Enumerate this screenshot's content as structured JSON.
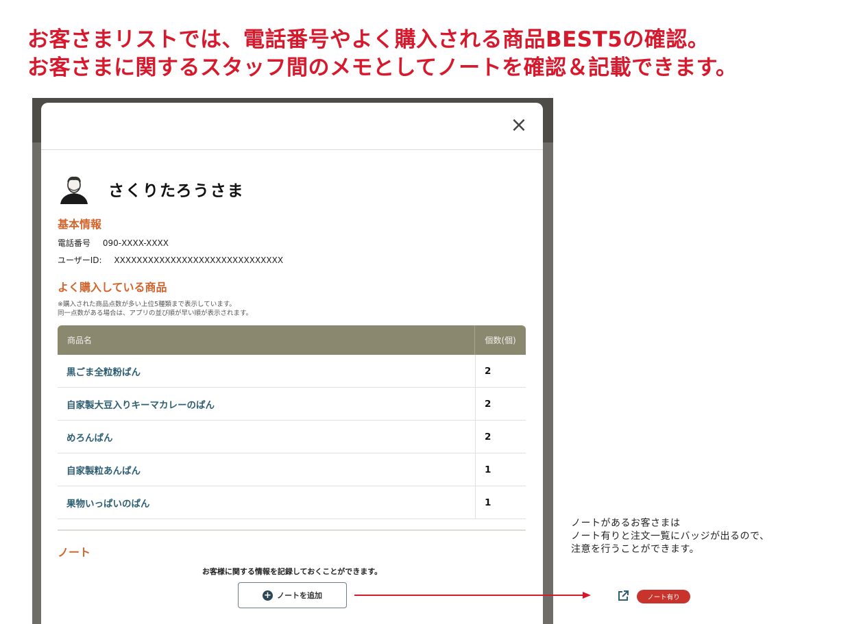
{
  "headline": {
    "line1": "お客さまリストでは、電話番号やよく購入される商品BEST5の確認。",
    "line2": "お客さまに関するスタッフ間のメモとしてノートを確認＆記載できます。"
  },
  "modal": {
    "close_label": "×",
    "customer_name": "さくりたろうさま",
    "basic_info": {
      "title": "基本情報",
      "phone_label": "電話番号",
      "phone_value": "090-XXXX-XXXX",
      "userid_label": "ユーザーID:",
      "userid_value": "XXXXXXXXXXXXXXXXXXXXXXXXXXXXXX"
    },
    "products": {
      "title": "よく購入している商品",
      "note_line1": "※購入された商品点数が多い上位5種類まで表示しています。",
      "note_line2": "同一点数がある場合は、アプリの並び順が早い順が表示されます。",
      "headers": [
        "商品名",
        "個数(個)"
      ],
      "rows": [
        {
          "name": "黒ごま全粒粉ぱん",
          "qty": "2"
        },
        {
          "name": "自家製大豆入りキーマカレーのぱん",
          "qty": "2"
        },
        {
          "name": "めろんぱん",
          "qty": "2"
        },
        {
          "name": "自家製粒あんぱん",
          "qty": "1"
        },
        {
          "name": "果物いっぱいのぱん",
          "qty": "1"
        }
      ]
    },
    "note": {
      "title": "ノート",
      "description": "お客様に関する情報を記録しておくことができます。",
      "add_button": "ノートを追加"
    }
  },
  "side": {
    "line1": "ノートがあるお客さまは",
    "line2": "ノート有りと注文一覧にバッジが出るので、",
    "line3": "注意を行うことができます。",
    "badge_label": "ノート有り"
  },
  "colors": {
    "headline": "#d6192c",
    "section_title": "#d2642c",
    "table_header": "#8b8870",
    "product_link": "#2d5f73",
    "badge": "#c8342c"
  }
}
